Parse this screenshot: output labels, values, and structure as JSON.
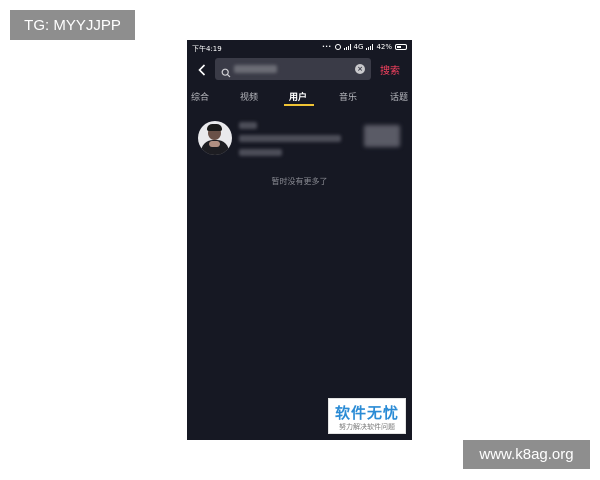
{
  "watermarks": {
    "tg": "TG: MYYJJPP",
    "site": "www.k8ag.org",
    "logo_main": "软件无忧",
    "logo_sub": "努力解决软件问题"
  },
  "status_bar": {
    "time": "下午4:19",
    "network": "4G",
    "battery": "42%"
  },
  "search": {
    "query": "",
    "button_label": "搜索"
  },
  "tabs": [
    {
      "label": "综合",
      "active": false
    },
    {
      "label": "视频",
      "active": false
    },
    {
      "label": "用户",
      "active": true
    },
    {
      "label": "音乐",
      "active": false
    },
    {
      "label": "话题",
      "active": false
    }
  ],
  "results": {
    "end_message": "暂时没有更多了"
  },
  "colors": {
    "background": "#161823",
    "accent": "#f5415f",
    "tab_indicator": "#f0c435"
  }
}
